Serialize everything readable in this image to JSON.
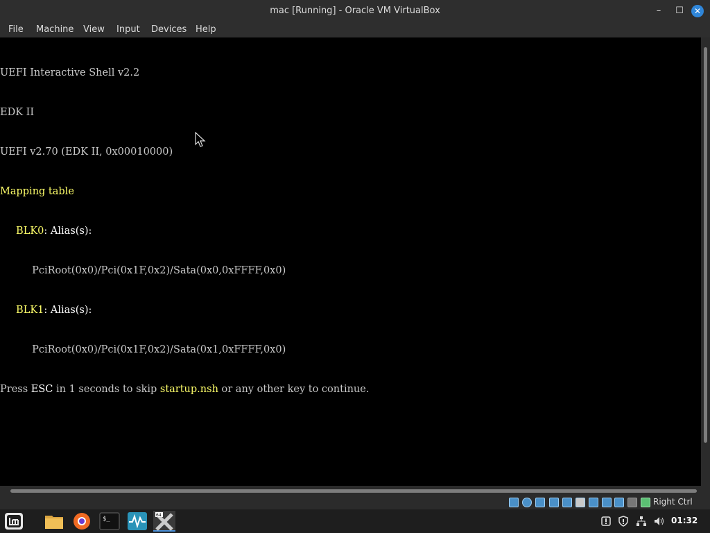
{
  "window": {
    "title": "mac [Running] - Oracle VM VirtualBox",
    "controls": {
      "minimize": "–",
      "maximize": "☐",
      "close": "✕"
    }
  },
  "menubar": {
    "items": [
      "File",
      "Machine",
      "View",
      "Input",
      "Devices",
      "Help"
    ]
  },
  "console": {
    "line1": "UEFI Interactive Shell v2.2",
    "line2": "EDK II",
    "line3": "UEFI v2.70 (EDK II, 0x00010000)",
    "line4": "Mapping table",
    "blk0_name": "BLK0",
    "blk0_alias": ": Alias(s):",
    "blk0_path": "PciRoot(0x0)/Pci(0x1F,0x2)/Sata(0x0,0xFFFF,0x0)",
    "blk1_name": "BLK1",
    "blk1_alias": ": Alias(s):",
    "blk1_path": "PciRoot(0x0)/Pci(0x1F,0x2)/Sata(0x1,0xFFFF,0x0)",
    "press": "Press ",
    "esc": "ESC",
    "in_seconds": " in 1 seconds to skip ",
    "startup": "startup.nsh",
    "continue": " or any other key to continue."
  },
  "statusbar": {
    "host_key": "Right Ctrl",
    "icons": [
      "hard-disk-icon",
      "optical-disk-icon",
      "audio-icon",
      "network-icon",
      "usb-icon",
      "shared-folders-icon",
      "display-icon",
      "recording-icon",
      "cpu-icon",
      "mouse-integration-icon",
      "keyboard-icon"
    ]
  },
  "taskbar": {
    "apps": [
      "menu-icon",
      "files-icon",
      "firefox-icon",
      "terminal-icon",
      "system-monitor-icon",
      "virtualbox-icon"
    ],
    "tray": [
      "update-icon",
      "shield-icon",
      "network-icon",
      "volume-icon"
    ],
    "clock": "01:32"
  },
  "colors": {
    "console_yellow": "#ffff6a",
    "console_grey": "#c8c8c8",
    "close_button": "#2f86d9"
  }
}
